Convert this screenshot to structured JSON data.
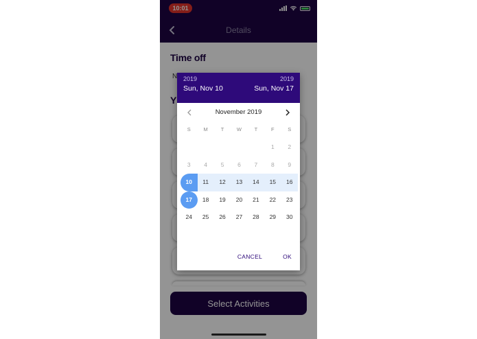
{
  "status_bar": {
    "time": "10:01",
    "icons": [
      "signal-icon",
      "wifi-icon",
      "battery-icon"
    ],
    "time_color": "#e5352b"
  },
  "nav": {
    "title": "Details",
    "back_icon": "chevron-left-icon"
  },
  "content": {
    "section_title": "Time off",
    "partial_text_1": "N",
    "partial_text_2": "Y",
    "select_button_label": "Select Activities"
  },
  "date_picker": {
    "start_year": "2019",
    "start_date": "Sun, Nov 10",
    "end_year": "2019",
    "end_date": "Sun, Nov 17",
    "month_label": "November 2019",
    "weekdays": [
      "S",
      "M",
      "T",
      "W",
      "T",
      "F",
      "S"
    ],
    "weeks": [
      [
        "",
        "",
        "",
        "",
        "",
        "1",
        "2"
      ],
      [
        "3",
        "4",
        "5",
        "6",
        "7",
        "8",
        "9"
      ],
      [
        "10",
        "11",
        "12",
        "13",
        "14",
        "15",
        "16"
      ],
      [
        "17",
        "18",
        "19",
        "20",
        "21",
        "22",
        "23"
      ],
      [
        "24",
        "25",
        "26",
        "27",
        "28",
        "29",
        "30"
      ]
    ],
    "selected_start": "10",
    "selected_end": "17",
    "cancel_label": "CANCEL",
    "ok_label": "OK",
    "header_color": "#2e0a7a",
    "selection_color": "#5b9cf2",
    "range_color": "#e4effc"
  },
  "brand_color": "#1e0444"
}
